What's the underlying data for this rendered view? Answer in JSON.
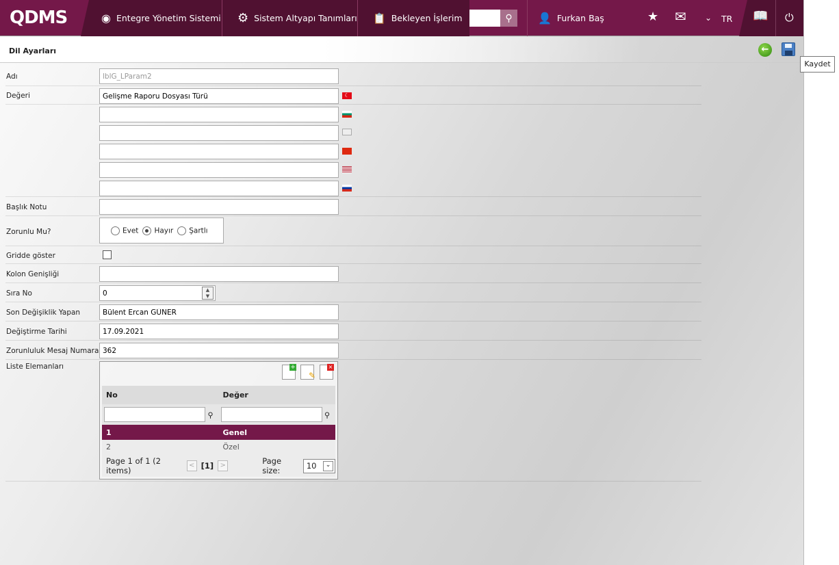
{
  "header": {
    "logo": "QDMS",
    "nav": [
      "Entegre Yönetim Sistemi",
      "Sistem Altyapı Tanımları",
      "Bekleyen İşlerim"
    ],
    "user": "Furkan Baş",
    "lang": "TR"
  },
  "page": {
    "title": "Dil Ayarları",
    "tooltip": "Kaydet"
  },
  "form": {
    "adi_label": "Adı",
    "adi_value": "lblG_LParam2",
    "degeri_label": "Değeri",
    "degeri_value": "Gelişme Raporu Dosyası Türü",
    "baslik_label": "Başlık Notu",
    "zorunlu_label": "Zorunlu Mu?",
    "radio": [
      "Evet",
      "Hayır",
      "Şartlı"
    ],
    "radio_selected": "Hayır",
    "gridde_label": "Gridde göster",
    "gridde_checked": false,
    "kolon_label": "Kolon Genişliği",
    "sira_label": "Sıra No",
    "sira_value": "0",
    "son_label": "Son Değişiklik Yapan",
    "son_value": "Bülent Ercan GÜNER",
    "tarih_label": "Değiştirme Tarihi",
    "tarih_value": "17.09.2021",
    "mesaj_label": "Zorunluluk Mesaj Numarası",
    "mesaj_value": "362",
    "liste_label": "Liste Elemanları"
  },
  "grid": {
    "columns": [
      "No",
      "Değer"
    ],
    "rows": [
      [
        "1",
        "Genel"
      ],
      [
        "2",
        "Özel"
      ]
    ],
    "pager": "Page 1 of 1 (2 items)",
    "current": "[1]",
    "page_size_label": "Page size:",
    "page_size": "10"
  }
}
